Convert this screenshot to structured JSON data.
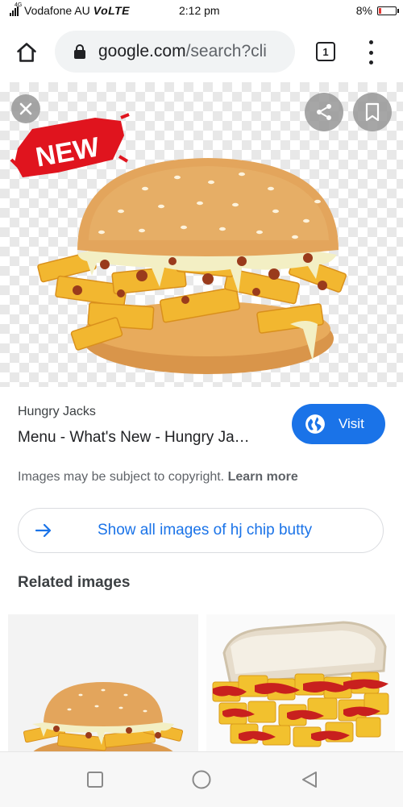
{
  "status_bar": {
    "network_tag": "4G",
    "carrier": "Vodafone AU",
    "volte": "VoLTE",
    "time": "2:12 pm",
    "battery": "8%",
    "battery_level": 0.08
  },
  "browser": {
    "url_host": "google.com",
    "url_path": "/search?cli",
    "tab_count": "1"
  },
  "image_viewer": {
    "close_icon": "close-icon",
    "share_icon": "share-icon",
    "bookmark_icon": "bookmark-icon",
    "badge_text": "NEW"
  },
  "result": {
    "source": "Hungry Jacks",
    "title": "Menu - What's New - Hungry Ja…",
    "visit_label": "Visit",
    "copyright_text": "Images may be subject to copyright.",
    "learn_more": "Learn more"
  },
  "show_all": {
    "label": "Show all images of hj chip butty"
  },
  "related": {
    "heading": "Related images"
  },
  "colors": {
    "accent": "#1a73e8",
    "battery_low": "#e53935",
    "badge_red": "#e0141e"
  }
}
